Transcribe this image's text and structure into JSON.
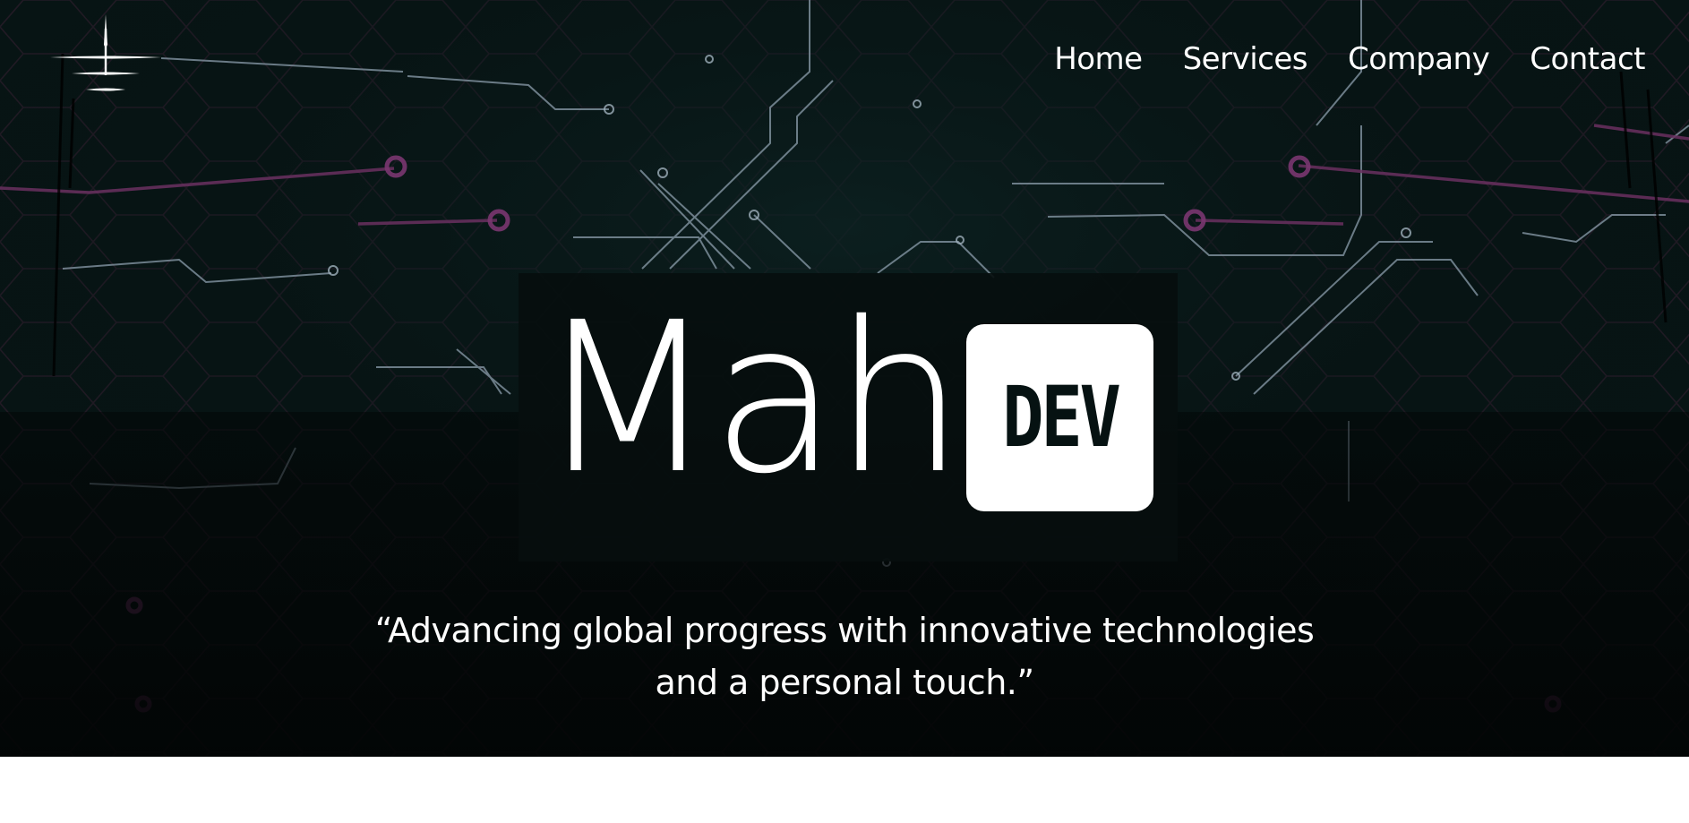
{
  "nav": {
    "items": [
      {
        "label": "Home"
      },
      {
        "label": "Services"
      },
      {
        "label": "Company"
      },
      {
        "label": "Contact"
      }
    ]
  },
  "brand": {
    "word": "Mah",
    "badge": "DEV"
  },
  "hero": {
    "tagline_line1": "“Advancing global progress with innovative technologies",
    "tagline_line2": "and a personal touch.”"
  },
  "colors": {
    "hero_background": "#071414",
    "circuit_light": "#8a9aa8",
    "circuit_accent": "#5a2a4e",
    "text": "#ffffff",
    "page_background": "#ffffff"
  },
  "icons": {
    "logo": "lighthouse-horizon-logo"
  }
}
